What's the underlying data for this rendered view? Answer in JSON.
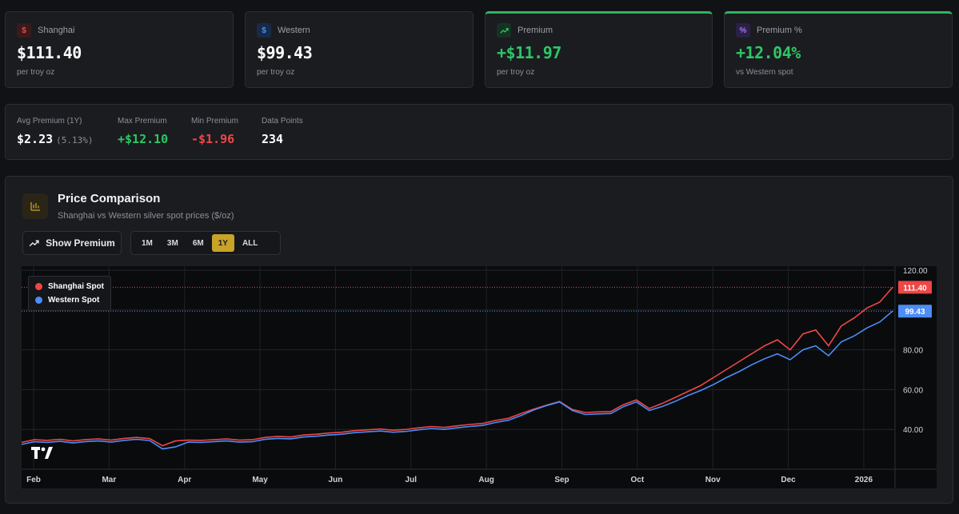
{
  "stats": [
    {
      "label": "Shanghai",
      "icon": "dollar-icon",
      "value": "$111.40",
      "sub": "per troy oz",
      "color": "#ef4646"
    },
    {
      "label": "Western",
      "icon": "dollar-icon",
      "value": "$99.43",
      "sub": "per troy oz",
      "color": "#4c8df6"
    },
    {
      "label": "Premium",
      "icon": "trending-up-icon",
      "value": "+$11.97",
      "sub": "per troy oz",
      "color": "#2fc665"
    },
    {
      "label": "Premium %",
      "icon": "percent-icon",
      "value": "+12.04%",
      "sub": "vs Western spot",
      "color": "#a279f0"
    }
  ],
  "summary": {
    "avg_label": "Avg Premium (1Y)",
    "avg_value": "$2.23",
    "avg_pct": "(5.13%)",
    "max_label": "Max Premium",
    "max_value": "+$12.10",
    "min_label": "Min Premium",
    "min_value": "-$1.96",
    "points_label": "Data Points",
    "points_value": "234"
  },
  "panel": {
    "title": "Price Comparison",
    "subtitle": "Shanghai vs Western silver spot prices ($/oz)",
    "show_premium": "Show Premium",
    "ranges": [
      "1M",
      "3M",
      "6M",
      "1Y",
      "ALL"
    ],
    "active_range": "1Y"
  },
  "chart_data": {
    "type": "line",
    "x_labels": [
      "Feb",
      "Mar",
      "Apr",
      "May",
      "Jun",
      "Jul",
      "Aug",
      "Sep",
      "Oct",
      "Nov",
      "Dec",
      "2026"
    ],
    "y_ticks": [
      "40.00",
      "60.00",
      "80.00",
      "100.00",
      "120.00"
    ],
    "ylim": [
      20,
      122
    ],
    "grid": true,
    "legend_position": "top-left",
    "series": [
      {
        "name": "Shanghai Spot",
        "color": "#ef4646",
        "last_label": "111.40",
        "values": [
          33.5,
          34.8,
          34.5,
          35.0,
          34.2,
          34.9,
          35.2,
          34.6,
          35.5,
          36.0,
          35.4,
          31.8,
          34.2,
          34.6,
          34.5,
          34.8,
          35.2,
          34.6,
          34.8,
          36.0,
          36.5,
          36.2,
          37.2,
          37.6,
          38.2,
          38.6,
          39.4,
          39.8,
          40.2,
          39.6,
          40.0,
          40.8,
          41.5,
          41.0,
          41.8,
          42.5,
          43.0,
          44.5,
          45.6,
          48.0,
          50.2,
          52.2,
          54.0,
          50.0,
          48.5,
          48.8,
          49.0,
          52.5,
          54.8,
          50.5,
          53.0,
          56.0,
          59.0,
          62.0,
          66.0,
          70.0,
          74.0,
          78.0,
          82.0,
          85.0,
          80.0,
          88.0,
          90.0,
          82.0,
          92.0,
          96.0,
          101.0,
          104.0,
          111.4
        ]
      },
      {
        "name": "Western Spot",
        "color": "#4c8df6",
        "last_label": "99.43",
        "values": [
          32.5,
          33.8,
          33.5,
          34.0,
          33.2,
          33.9,
          34.2,
          33.6,
          34.5,
          35.0,
          34.4,
          30.2,
          31.2,
          33.6,
          33.5,
          33.8,
          34.2,
          33.6,
          33.8,
          35.0,
          35.5,
          35.2,
          36.2,
          36.6,
          37.2,
          37.6,
          38.4,
          38.8,
          39.2,
          38.6,
          39.0,
          39.8,
          40.5,
          40.0,
          40.8,
          41.5,
          42.0,
          43.5,
          44.6,
          47.0,
          49.8,
          52.0,
          53.8,
          49.5,
          47.5,
          47.8,
          48.0,
          51.5,
          53.8,
          49.5,
          51.5,
          54.0,
          57.0,
          59.5,
          62.5,
          66.0,
          69.0,
          72.5,
          75.5,
          78.0,
          75.0,
          80.0,
          82.0,
          77.0,
          84.0,
          87.0,
          91.0,
          94.0,
          99.43
        ]
      }
    ]
  }
}
